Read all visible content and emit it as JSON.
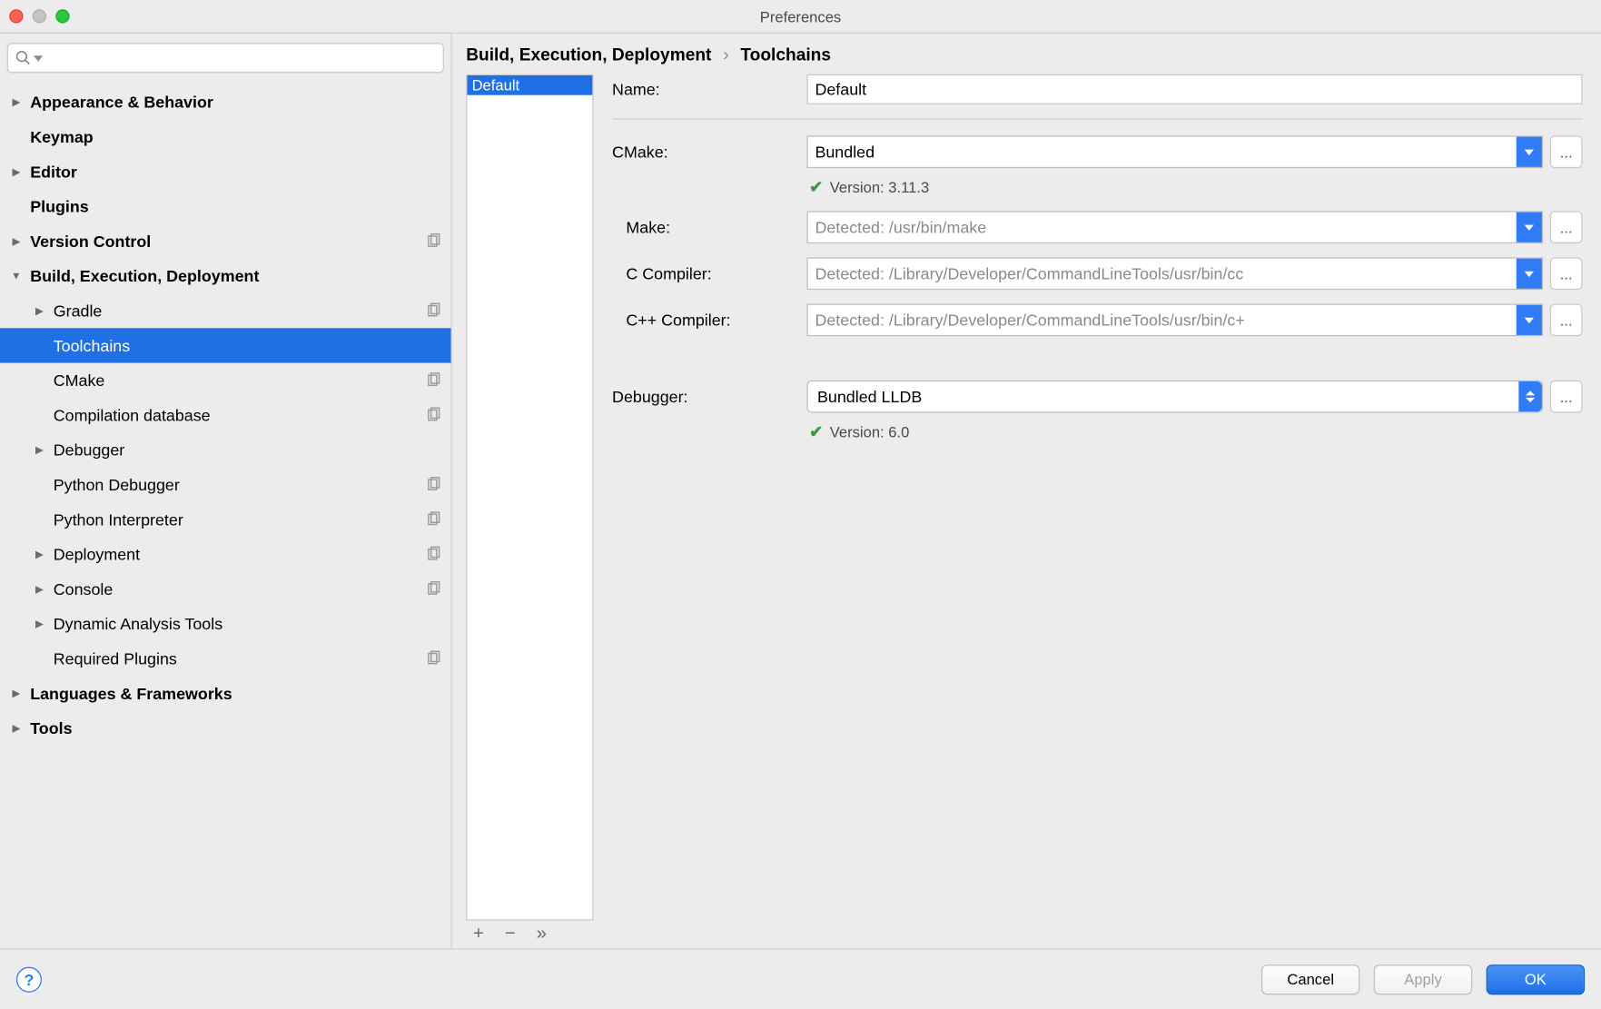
{
  "window": {
    "title": "Preferences"
  },
  "breadcrumb": {
    "parent": "Build, Execution, Deployment",
    "current": "Toolchains"
  },
  "sidebar": {
    "items": [
      {
        "label": "Appearance & Behavior",
        "bold": true,
        "arrow": "right",
        "indent": 0
      },
      {
        "label": "Keymap",
        "bold": true,
        "arrow": "",
        "indent": 0
      },
      {
        "label": "Editor",
        "bold": true,
        "arrow": "right",
        "indent": 0
      },
      {
        "label": "Plugins",
        "bold": true,
        "arrow": "",
        "indent": 0
      },
      {
        "label": "Version Control",
        "bold": true,
        "arrow": "right",
        "indent": 0,
        "copy": true
      },
      {
        "label": "Build, Execution, Deployment",
        "bold": true,
        "arrow": "down",
        "indent": 0
      },
      {
        "label": "Gradle",
        "bold": false,
        "arrow": "right",
        "indent": 1,
        "copy": true
      },
      {
        "label": "Toolchains",
        "bold": false,
        "arrow": "",
        "indent": 1,
        "selected": true
      },
      {
        "label": "CMake",
        "bold": false,
        "arrow": "",
        "indent": 1,
        "copy": true
      },
      {
        "label": "Compilation database",
        "bold": false,
        "arrow": "",
        "indent": 1,
        "copy": true
      },
      {
        "label": "Debugger",
        "bold": false,
        "arrow": "right",
        "indent": 1
      },
      {
        "label": "Python Debugger",
        "bold": false,
        "arrow": "",
        "indent": 1,
        "copy": true
      },
      {
        "label": "Python Interpreter",
        "bold": false,
        "arrow": "",
        "indent": 1,
        "copy": true
      },
      {
        "label": "Deployment",
        "bold": false,
        "arrow": "right",
        "indent": 1,
        "copy": true
      },
      {
        "label": "Console",
        "bold": false,
        "arrow": "right",
        "indent": 1,
        "copy": true
      },
      {
        "label": "Dynamic Analysis Tools",
        "bold": false,
        "arrow": "right",
        "indent": 1
      },
      {
        "label": "Required Plugins",
        "bold": false,
        "arrow": "",
        "indent": 1,
        "copy": true
      },
      {
        "label": "Languages & Frameworks",
        "bold": true,
        "arrow": "right",
        "indent": 0
      },
      {
        "label": "Tools",
        "bold": true,
        "arrow": "right",
        "indent": 0
      }
    ]
  },
  "profiles": {
    "items": [
      "Default"
    ],
    "selected": "Default"
  },
  "form": {
    "name_label": "Name:",
    "name_value": "Default",
    "cmake_label": "CMake:",
    "cmake_value": "Bundled",
    "cmake_status": "Version: 3.11.3",
    "make_label": "Make:",
    "make_placeholder": "Detected: /usr/bin/make",
    "cc_label": "C Compiler:",
    "cc_placeholder": "Detected: /Library/Developer/CommandLineTools/usr/bin/cc",
    "cxx_label": "C++ Compiler:",
    "cxx_placeholder": "Detected: /Library/Developer/CommandLineTools/usr/bin/c+",
    "debugger_label": "Debugger:",
    "debugger_value": "Bundled LLDB",
    "debugger_status": "Version: 6.0",
    "browse": "..."
  },
  "footer": {
    "cancel": "Cancel",
    "apply": "Apply",
    "ok": "OK"
  }
}
